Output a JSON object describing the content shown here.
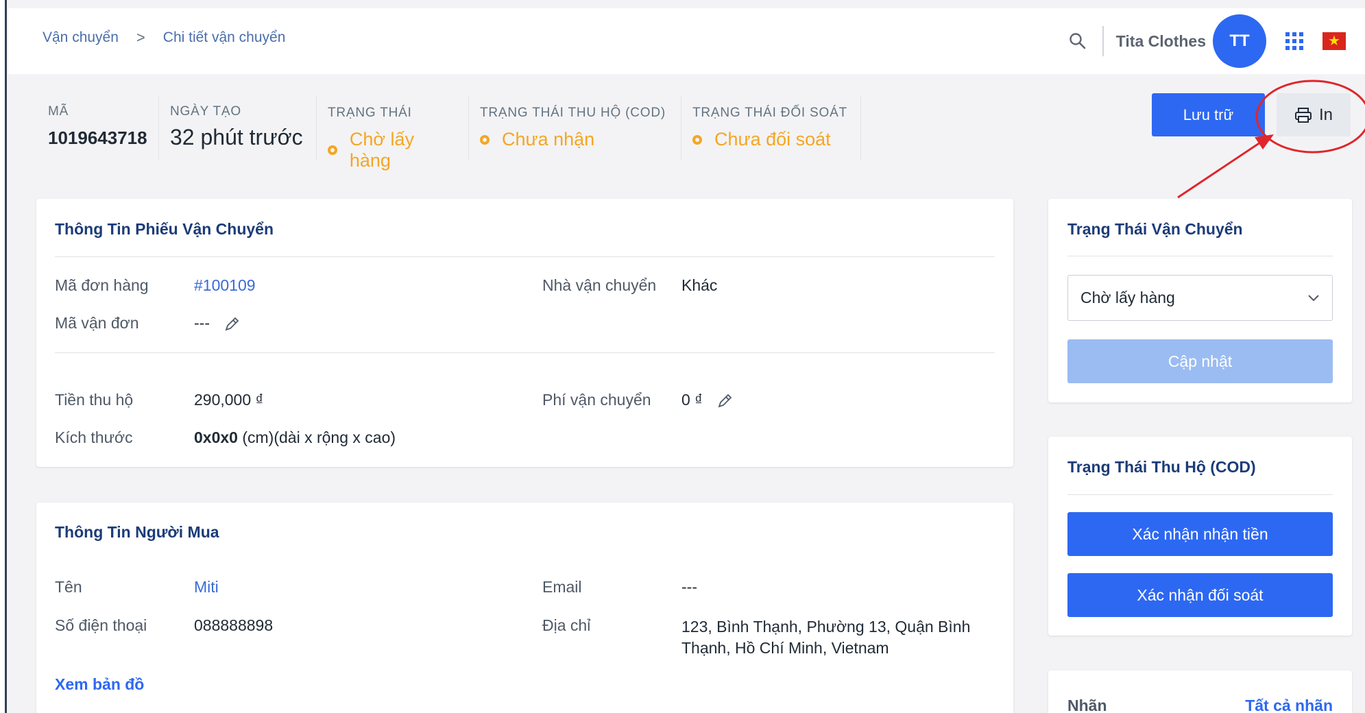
{
  "breadcrumb": [
    "Vận chuyển",
    "Chi tiết vận chuyển"
  ],
  "breadcrumb_separator": ">",
  "header": {
    "shop_name": "Tita Clothes",
    "avatar_initials": "TT"
  },
  "summary": {
    "code_label": "MÃ",
    "code_value": "1019643718",
    "created_label": "NGÀY TẠO",
    "created_value": "32 phút trước",
    "status_label": "TRẠNG THÁI",
    "status_value": "Chờ lấy hàng",
    "cod_label": "TRẠNG THÁI THU HỘ (COD)",
    "cod_value": "Chưa nhận",
    "reconcile_label": "TRẠNG THÁI ĐỐI SOÁT",
    "reconcile_value": "Chưa đối soát",
    "status_color": "#f5a623"
  },
  "actions": {
    "archive": "Lưu trữ",
    "print": "In"
  },
  "shipment": {
    "title": "Thông Tin Phiếu Vận Chuyển",
    "order_code_label": "Mã đơn hàng",
    "order_code_value": "#100109",
    "carrier_label": "Nhà vận chuyển",
    "carrier_value": "Khác",
    "tracking_label": "Mã vận đơn",
    "tracking_value": "---",
    "cod_label": "Tiền thu hộ",
    "cod_value": "290,000 ₫",
    "fee_label": "Phí vận chuyển",
    "fee_value": "0 ₫",
    "size_label": "Kích thước",
    "size_value": "0x0x0",
    "size_unit": "(cm)(dài x rộng x cao)"
  },
  "buyer": {
    "title": "Thông Tin Người Mua",
    "name_label": "Tên",
    "name_value": "Miti",
    "email_label": "Email",
    "email_value": "---",
    "phone_label": "Số điện thoại",
    "phone_value": "088888898",
    "address_label": "Địa chỉ",
    "address_line1": "123, Bình Thạnh, Phường 13, Quận Bình",
    "address_line2": "Thạnh, Hồ Chí Minh, Vietnam",
    "map_link": "Xem bản đồ"
  },
  "shipping_status": {
    "title": "Trạng Thái Vận Chuyển",
    "selected": "Chờ lấy hàng",
    "update_button": "Cập nhật"
  },
  "cod_status": {
    "title": "Trạng Thái Thu Hộ (COD)",
    "confirm_received": "Xác nhận nhận tiền",
    "confirm_reconcile": "Xác nhận đối soát"
  },
  "tags": {
    "title": "Nhãn",
    "all_link": "Tất cả nhãn"
  },
  "colors": {
    "primary": "#2d68f2",
    "primary_disabled": "#9bbcf2",
    "annotation": "#e0262b"
  }
}
